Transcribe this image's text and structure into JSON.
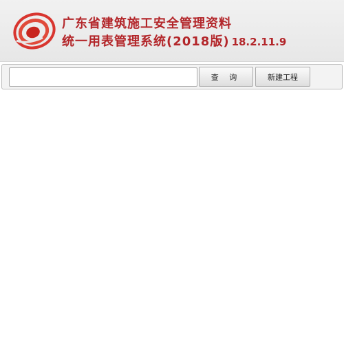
{
  "header": {
    "title_line1": "广东省建筑施工安全管理资料",
    "title_line2": "统一用表管理系统(2018版)",
    "version": "18.2.11.9",
    "logo": "red-swirl-logo",
    "accent_color": "#b3262a"
  },
  "toolbar": {
    "search": {
      "value": "",
      "placeholder": ""
    },
    "query_label": "查 询",
    "new_project_label": "新建工程"
  }
}
